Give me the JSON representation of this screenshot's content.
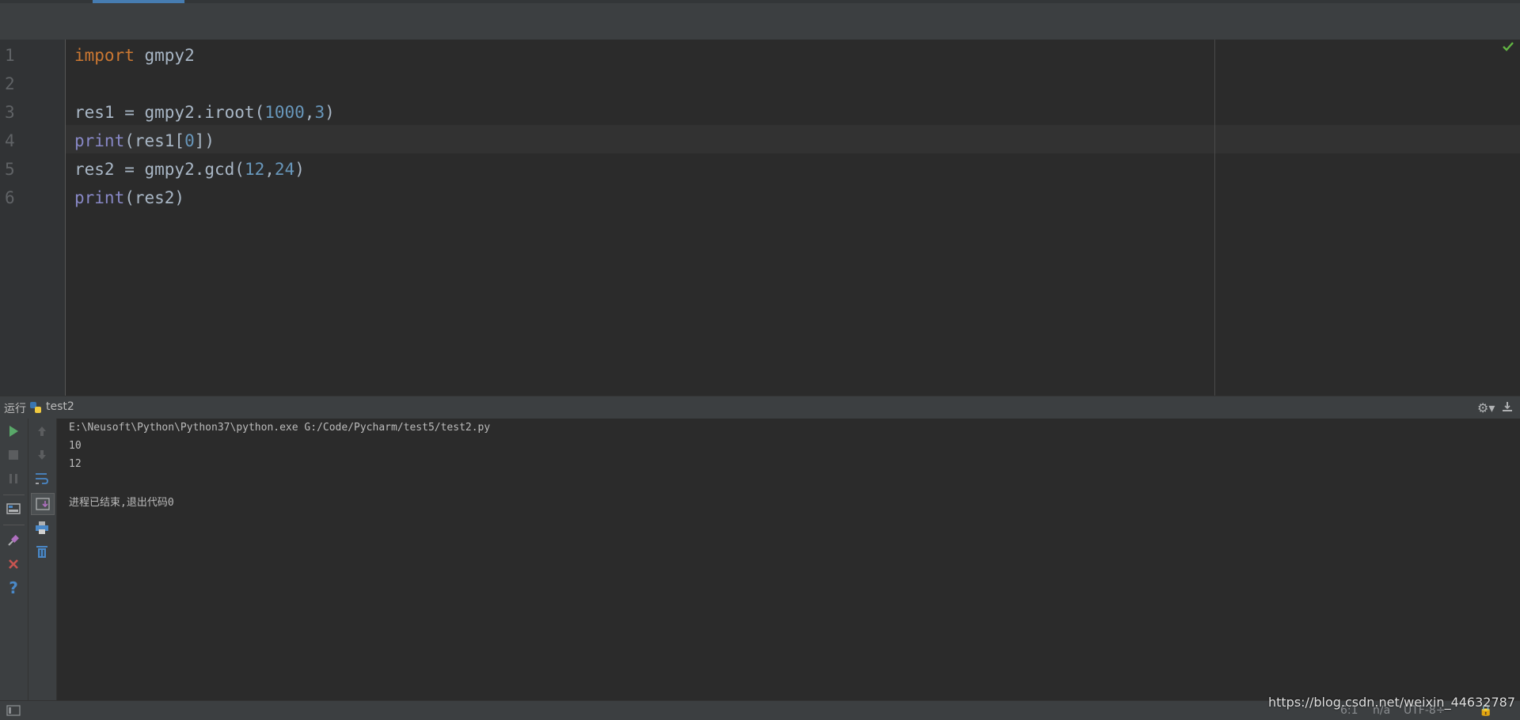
{
  "editor": {
    "lines": [
      {
        "no": "1",
        "tokens": [
          {
            "t": "import",
            "c": "kw"
          },
          {
            "t": " gmpy2",
            "c": ""
          }
        ]
      },
      {
        "no": "2",
        "tokens": []
      },
      {
        "no": "3",
        "tokens": [
          {
            "t": "res1 = gmpy2.iroot(",
            "c": ""
          },
          {
            "t": "1000",
            "c": "num"
          },
          {
            "t": ",",
            "c": ""
          },
          {
            "t": "3",
            "c": "num"
          },
          {
            "t": ")",
            "c": ""
          }
        ]
      },
      {
        "no": "4",
        "tokens": [
          {
            "t": "print",
            "c": "bi"
          },
          {
            "t": "(res1[",
            "c": ""
          },
          {
            "t": "0",
            "c": "num"
          },
          {
            "t": "])",
            "c": ""
          }
        ]
      },
      {
        "no": "5",
        "tokens": [
          {
            "t": "res2 = gmpy2.gcd(",
            "c": ""
          },
          {
            "t": "12",
            "c": "num"
          },
          {
            "t": ",",
            "c": ""
          },
          {
            "t": "24",
            "c": "num"
          },
          {
            "t": ")",
            "c": ""
          }
        ]
      },
      {
        "no": "6",
        "tokens": [
          {
            "t": "print",
            "c": "bi"
          },
          {
            "t": "(res2)",
            "c": ""
          }
        ]
      }
    ]
  },
  "run_panel": {
    "label": "运行",
    "config_name": "test2",
    "console_lines": [
      "E:\\Neusoft\\Python\\Python37\\python.exe G:/Code/Pycharm/test5/test2.py",
      "10",
      "12",
      "",
      "进程已结束,退出代码0"
    ]
  },
  "status_bar": {
    "position": "6:1",
    "line_sep": "n/a",
    "encoding": "UTF-8÷",
    "watermark": "https://blog.csdn.net/weixin_44632787"
  },
  "colors": {
    "keyword": "#cc7832",
    "builtin": "#8888c6",
    "number": "#6897bb",
    "text": "#a9b7c6",
    "background": "#2b2b2b"
  }
}
